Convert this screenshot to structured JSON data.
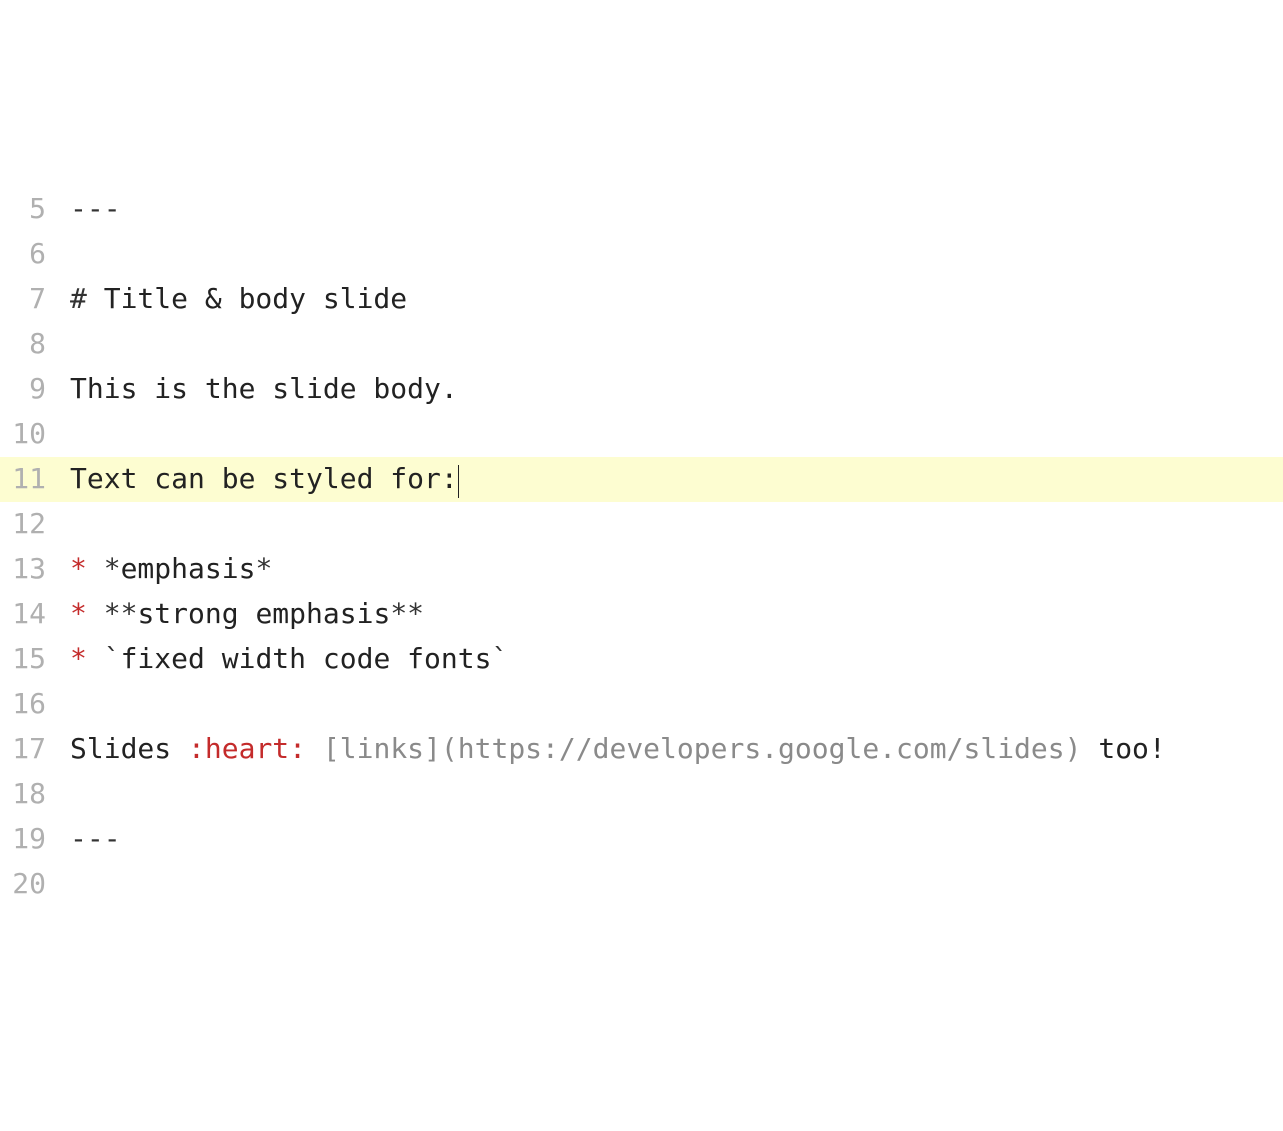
{
  "editor": {
    "startLine": 5,
    "highlightLine": 11,
    "cursorLine": 11,
    "lines": [
      {
        "n": 5,
        "segments": [
          {
            "t": "---",
            "c": "tok-punct"
          }
        ]
      },
      {
        "n": 6,
        "segments": []
      },
      {
        "n": 7,
        "segments": [
          {
            "t": "#",
            "c": "tok-punct"
          },
          {
            "t": " Title & body slide",
            "c": "tok-header"
          }
        ]
      },
      {
        "n": 8,
        "segments": []
      },
      {
        "n": 9,
        "segments": [
          {
            "t": "This is the slide body.",
            "c": ""
          }
        ]
      },
      {
        "n": 10,
        "segments": []
      },
      {
        "n": 11,
        "segments": [
          {
            "t": "Text can be styled for:",
            "c": ""
          }
        ]
      },
      {
        "n": 12,
        "segments": []
      },
      {
        "n": 13,
        "segments": [
          {
            "t": "*",
            "c": "tok-red"
          },
          {
            "t": " ",
            "c": ""
          },
          {
            "t": "*",
            "c": "tok-punct"
          },
          {
            "t": "emphasis",
            "c": ""
          },
          {
            "t": "*",
            "c": "tok-punct"
          }
        ]
      },
      {
        "n": 14,
        "segments": [
          {
            "t": "*",
            "c": "tok-red"
          },
          {
            "t": " ",
            "c": ""
          },
          {
            "t": "**",
            "c": "tok-punct"
          },
          {
            "t": "strong emphasis",
            "c": ""
          },
          {
            "t": "**",
            "c": "tok-punct"
          }
        ]
      },
      {
        "n": 15,
        "segments": [
          {
            "t": "*",
            "c": "tok-red"
          },
          {
            "t": " ",
            "c": ""
          },
          {
            "t": "`",
            "c": "tok-punct"
          },
          {
            "t": "fixed width code fonts",
            "c": ""
          },
          {
            "t": "`",
            "c": "tok-punct"
          }
        ]
      },
      {
        "n": 16,
        "segments": []
      },
      {
        "n": 17,
        "segments": [
          {
            "t": "Slides ",
            "c": ""
          },
          {
            "t": ":heart:",
            "c": "tok-red"
          },
          {
            "t": " ",
            "c": ""
          },
          {
            "t": "[links](https://developers.google.com/slides)",
            "c": "tok-link"
          },
          {
            "t": " too!",
            "c": ""
          }
        ]
      },
      {
        "n": 18,
        "segments": []
      },
      {
        "n": 19,
        "segments": [
          {
            "t": "---",
            "c": "tok-punct"
          }
        ]
      },
      {
        "n": 20,
        "segments": []
      }
    ]
  }
}
